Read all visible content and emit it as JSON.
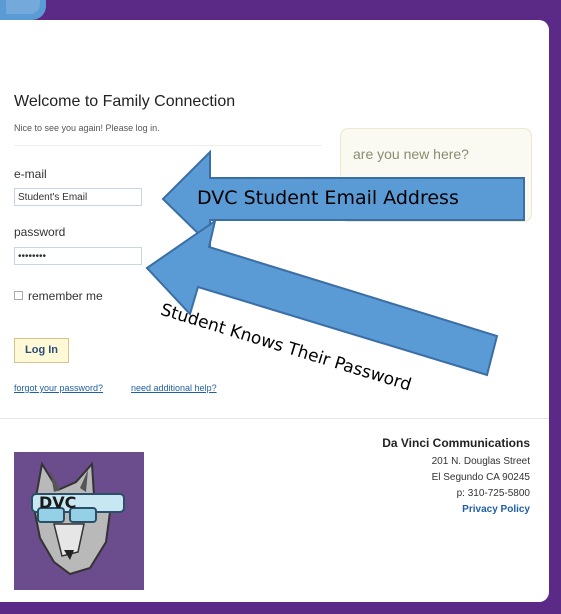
{
  "login": {
    "title": "Welcome to Family Connection",
    "subtitle": "Nice to see you again! Please log in.",
    "email_label": "e-mail",
    "email_value": "Student's Email",
    "password_label": "password",
    "password_value": "••••••••",
    "remember_label": "remember me",
    "remember_checked": false,
    "login_button": "Log In",
    "forgot_link": "forgot your password?",
    "help_link": "need additional help?"
  },
  "new_here": {
    "label": "are you new here?"
  },
  "annotations": {
    "arrow_email": "DVC Student Email Address",
    "arrow_password": "Student Knows Their Password"
  },
  "footer": {
    "company": "Da Vinci Communications",
    "address1": "201 N. Douglas Street",
    "address2": "El Segundo CA 90245",
    "phone": "p: 310-725-5800",
    "privacy": "Privacy Policy",
    "logo_text": "DVC"
  },
  "colors": {
    "frame": "#5b2a86",
    "arrow_fill": "#5b9bd5",
    "arrow_stroke": "#3a6ea5",
    "link": "#1f5fa3",
    "button_bg": "#fff9d8"
  }
}
